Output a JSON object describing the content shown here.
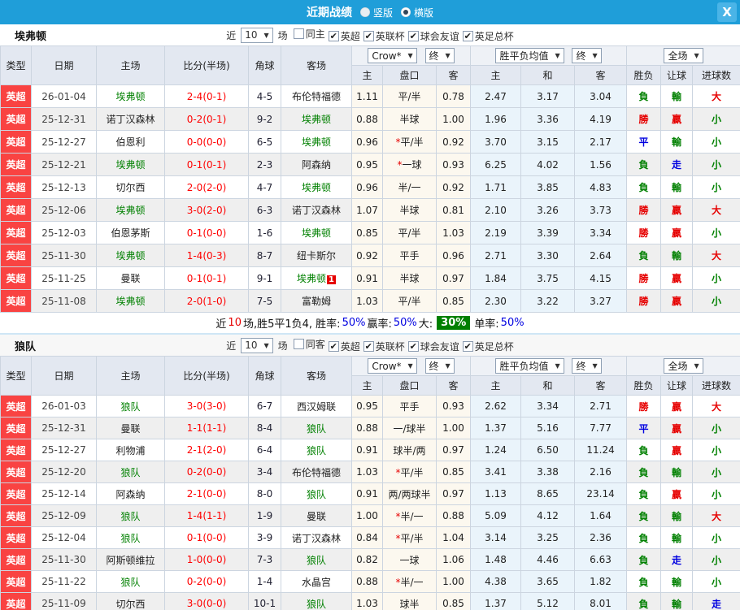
{
  "window": {
    "title": "近期战绩",
    "view_options": [
      {
        "label": "竖版",
        "selected": false
      },
      {
        "label": "横版",
        "selected": true
      }
    ],
    "close_label": "X"
  },
  "legend": {
    "star_char": "*",
    "dropdown_arrow": "▼"
  },
  "colors": {
    "titlebar_blue": "#1f9ed9",
    "league_badge_red": "#f94342",
    "score_red": "#ff0000",
    "team_green": "#008000",
    "win_red": "#e60000",
    "lose_green": "#008000",
    "draw_blue": "#0000e0",
    "summary_pct_green_bg": "#008000",
    "handicap_col_bg": "#fcf8ef",
    "odds_col_bg": "#eaf4fb"
  },
  "table_header": {
    "near_label": "近",
    "matches_label": "场",
    "col_type": "类型",
    "col_date": "日期",
    "col_home": "主场",
    "col_score": "比分(半场)",
    "col_corner": "角球",
    "col_away": "客场",
    "odds_source_select": "Crow*",
    "final_select": "终",
    "avg_select": "胜平负均值",
    "final_select2": "终",
    "scope_select": "全场",
    "sub_home": "主",
    "sub_handicap": "盘口",
    "sub_away": "客",
    "sub_win": "主",
    "sub_draw": "和",
    "sub_lose": "客",
    "sub_wdl": "胜负",
    "sub_ah": "让球",
    "sub_goals": "进球数"
  },
  "teams": [
    {
      "name": "埃弗顿",
      "near_count": "10",
      "filters": [
        {
          "label": "同主",
          "checked": false
        },
        {
          "label": "英超",
          "checked": true
        },
        {
          "label": "英联杯",
          "checked": true
        },
        {
          "label": "球会友谊",
          "checked": true
        },
        {
          "label": "英足总杯",
          "checked": true
        }
      ],
      "rows": [
        {
          "league": "英超",
          "date": "26-01-04",
          "home": "埃弗顿",
          "score": "2-4(0-1)",
          "corner": "4-5",
          "away": "布伦特福德",
          "h_odds": "1.11",
          "handicap": "平/半",
          "handicap_star": false,
          "a_odds": "0.78",
          "win": "2.47",
          "draw": "3.17",
          "lose": "3.04",
          "wdl": "負",
          "ah": "輸",
          "ou": "大"
        },
        {
          "league": "英超",
          "date": "25-12-31",
          "home": "诺丁汉森林",
          "score": "0-2(0-1)",
          "corner": "9-2",
          "away": "埃弗顿",
          "h_odds": "0.88",
          "handicap": "半球",
          "handicap_star": false,
          "a_odds": "1.00",
          "win": "1.96",
          "draw": "3.36",
          "lose": "4.19",
          "wdl": "勝",
          "ah": "贏",
          "ou": "小"
        },
        {
          "league": "英超",
          "date": "25-12-27",
          "home": "伯恩利",
          "score": "0-0(0-0)",
          "corner": "6-5",
          "away": "埃弗顿",
          "h_odds": "0.96",
          "handicap": "平/半",
          "handicap_star": true,
          "a_odds": "0.92",
          "win": "3.70",
          "draw": "3.15",
          "lose": "2.17",
          "wdl": "平",
          "ah": "輸",
          "ou": "小"
        },
        {
          "league": "英超",
          "date": "25-12-21",
          "home": "埃弗顿",
          "score": "0-1(0-1)",
          "corner": "2-3",
          "away": "阿森纳",
          "h_odds": "0.95",
          "handicap": "一球",
          "handicap_star": true,
          "a_odds": "0.93",
          "win": "6.25",
          "draw": "4.02",
          "lose": "1.56",
          "wdl": "負",
          "ah": "走",
          "ou": "小"
        },
        {
          "league": "英超",
          "date": "25-12-13",
          "home": "切尔西",
          "score": "2-0(2-0)",
          "corner": "4-7",
          "away": "埃弗顿",
          "h_odds": "0.96",
          "handicap": "半/一",
          "handicap_star": false,
          "a_odds": "0.92",
          "win": "1.71",
          "draw": "3.85",
          "lose": "4.83",
          "wdl": "負",
          "ah": "輸",
          "ou": "小"
        },
        {
          "league": "英超",
          "date": "25-12-06",
          "home": "埃弗顿",
          "score": "3-0(2-0)",
          "corner": "6-3",
          "away": "诺丁汉森林",
          "h_odds": "1.07",
          "handicap": "半球",
          "handicap_star": false,
          "a_odds": "0.81",
          "win": "2.10",
          "draw": "3.26",
          "lose": "3.73",
          "wdl": "勝",
          "ah": "贏",
          "ou": "大"
        },
        {
          "league": "英超",
          "date": "25-12-03",
          "home": "伯恩茅斯",
          "score": "0-1(0-0)",
          "corner": "1-6",
          "away": "埃弗顿",
          "h_odds": "0.85",
          "handicap": "平/半",
          "handicap_star": false,
          "a_odds": "1.03",
          "win": "2.19",
          "draw": "3.39",
          "lose": "3.34",
          "wdl": "勝",
          "ah": "贏",
          "ou": "小"
        },
        {
          "league": "英超",
          "date": "25-11-30",
          "home": "埃弗顿",
          "score": "1-4(0-3)",
          "corner": "8-7",
          "away": "纽卡斯尔",
          "h_odds": "0.92",
          "handicap": "平手",
          "handicap_star": false,
          "a_odds": "0.96",
          "win": "2.71",
          "draw": "3.30",
          "lose": "2.64",
          "wdl": "負",
          "ah": "輸",
          "ou": "大"
        },
        {
          "league": "英超",
          "date": "25-11-25",
          "home": "曼联",
          "score": "0-1(0-1)",
          "corner": "9-1",
          "away": "埃弗顿",
          "away_badge": "1",
          "h_odds": "0.91",
          "handicap": "半球",
          "handicap_star": false,
          "a_odds": "0.97",
          "win": "1.84",
          "draw": "3.75",
          "lose": "4.15",
          "wdl": "勝",
          "ah": "贏",
          "ou": "小"
        },
        {
          "league": "英超",
          "date": "25-11-08",
          "home": "埃弗顿",
          "score": "2-0(1-0)",
          "corner": "7-5",
          "away": "富勒姆",
          "h_odds": "1.03",
          "handicap": "平/半",
          "handicap_star": false,
          "a_odds": "0.85",
          "win": "2.30",
          "draw": "3.22",
          "lose": "3.27",
          "wdl": "勝",
          "ah": "贏",
          "ou": "小"
        }
      ],
      "summary": {
        "prefix": "近",
        "count": "10",
        "middle": "场,胜5平1负4, 胜率:",
        "rate1": "50%",
        "label2": "赢率:",
        "rate2": "50%",
        "label3": "大:",
        "big": "30%",
        "label4": "单率:",
        "rate3": "50%"
      }
    },
    {
      "name": "狼队",
      "near_count": "10",
      "filters": [
        {
          "label": "同客",
          "checked": false
        },
        {
          "label": "英超",
          "checked": true
        },
        {
          "label": "英联杯",
          "checked": true
        },
        {
          "label": "球会友谊",
          "checked": true
        },
        {
          "label": "英足总杯",
          "checked": true
        }
      ],
      "rows": [
        {
          "league": "英超",
          "date": "26-01-03",
          "home": "狼队",
          "score": "3-0(3-0)",
          "corner": "6-7",
          "away": "西汉姆联",
          "h_odds": "0.95",
          "handicap": "平手",
          "handicap_star": false,
          "a_odds": "0.93",
          "win": "2.62",
          "draw": "3.34",
          "lose": "2.71",
          "wdl": "勝",
          "ah": "贏",
          "ou": "大"
        },
        {
          "league": "英超",
          "date": "25-12-31",
          "home": "曼联",
          "score": "1-1(1-1)",
          "corner": "8-4",
          "away": "狼队",
          "h_odds": "0.88",
          "handicap": "一/球半",
          "handicap_star": false,
          "a_odds": "1.00",
          "win": "1.37",
          "draw": "5.16",
          "lose": "7.77",
          "wdl": "平",
          "ah": "贏",
          "ou": "小"
        },
        {
          "league": "英超",
          "date": "25-12-27",
          "home": "利物浦",
          "score": "2-1(2-0)",
          "corner": "6-4",
          "away": "狼队",
          "h_odds": "0.91",
          "handicap": "球半/两",
          "handicap_star": false,
          "a_odds": "0.97",
          "win": "1.24",
          "draw": "6.50",
          "lose": "11.24",
          "wdl": "負",
          "ah": "贏",
          "ou": "小"
        },
        {
          "league": "英超",
          "date": "25-12-20",
          "home": "狼队",
          "score": "0-2(0-0)",
          "corner": "3-4",
          "away": "布伦特福德",
          "h_odds": "1.03",
          "handicap": "平/半",
          "handicap_star": true,
          "a_odds": "0.85",
          "win": "3.41",
          "draw": "3.38",
          "lose": "2.16",
          "wdl": "負",
          "ah": "輸",
          "ou": "小"
        },
        {
          "league": "英超",
          "date": "25-12-14",
          "home": "阿森纳",
          "score": "2-1(0-0)",
          "corner": "8-0",
          "away": "狼队",
          "h_odds": "0.91",
          "handicap": "两/两球半",
          "handicap_star": false,
          "a_odds": "0.97",
          "win": "1.13",
          "draw": "8.65",
          "lose": "23.14",
          "wdl": "負",
          "ah": "贏",
          "ou": "小"
        },
        {
          "league": "英超",
          "date": "25-12-09",
          "home": "狼队",
          "score": "1-4(1-1)",
          "corner": "1-9",
          "away": "曼联",
          "h_odds": "1.00",
          "handicap": "半/一",
          "handicap_star": true,
          "a_odds": "0.88",
          "win": "5.09",
          "draw": "4.12",
          "lose": "1.64",
          "wdl": "負",
          "ah": "輸",
          "ou": "大"
        },
        {
          "league": "英超",
          "date": "25-12-04",
          "home": "狼队",
          "score": "0-1(0-0)",
          "corner": "3-9",
          "away": "诺丁汉森林",
          "h_odds": "0.84",
          "handicap": "平/半",
          "handicap_star": true,
          "a_odds": "1.04",
          "win": "3.14",
          "draw": "3.25",
          "lose": "2.36",
          "wdl": "負",
          "ah": "輸",
          "ou": "小"
        },
        {
          "league": "英超",
          "date": "25-11-30",
          "home": "阿斯顿维拉",
          "score": "1-0(0-0)",
          "corner": "7-3",
          "away": "狼队",
          "h_odds": "0.82",
          "handicap": "一球",
          "handicap_star": false,
          "a_odds": "1.06",
          "win": "1.48",
          "draw": "4.46",
          "lose": "6.63",
          "wdl": "負",
          "ah": "走",
          "ou": "小"
        },
        {
          "league": "英超",
          "date": "25-11-22",
          "home": "狼队",
          "score": "0-2(0-0)",
          "corner": "1-4",
          "away": "水晶宫",
          "h_odds": "0.88",
          "handicap": "半/一",
          "handicap_star": true,
          "a_odds": "1.00",
          "win": "4.38",
          "draw": "3.65",
          "lose": "1.82",
          "wdl": "負",
          "ah": "輸",
          "ou": "小"
        },
        {
          "league": "英超",
          "date": "25-11-09",
          "home": "切尔西",
          "score": "3-0(0-0)",
          "corner": "10-1",
          "away": "狼队",
          "h_odds": "1.03",
          "handicap": "球半",
          "handicap_star": false,
          "a_odds": "0.85",
          "win": "1.37",
          "draw": "5.12",
          "lose": "8.01",
          "wdl": "負",
          "ah": "輸",
          "ou": "走"
        }
      ]
    }
  ]
}
